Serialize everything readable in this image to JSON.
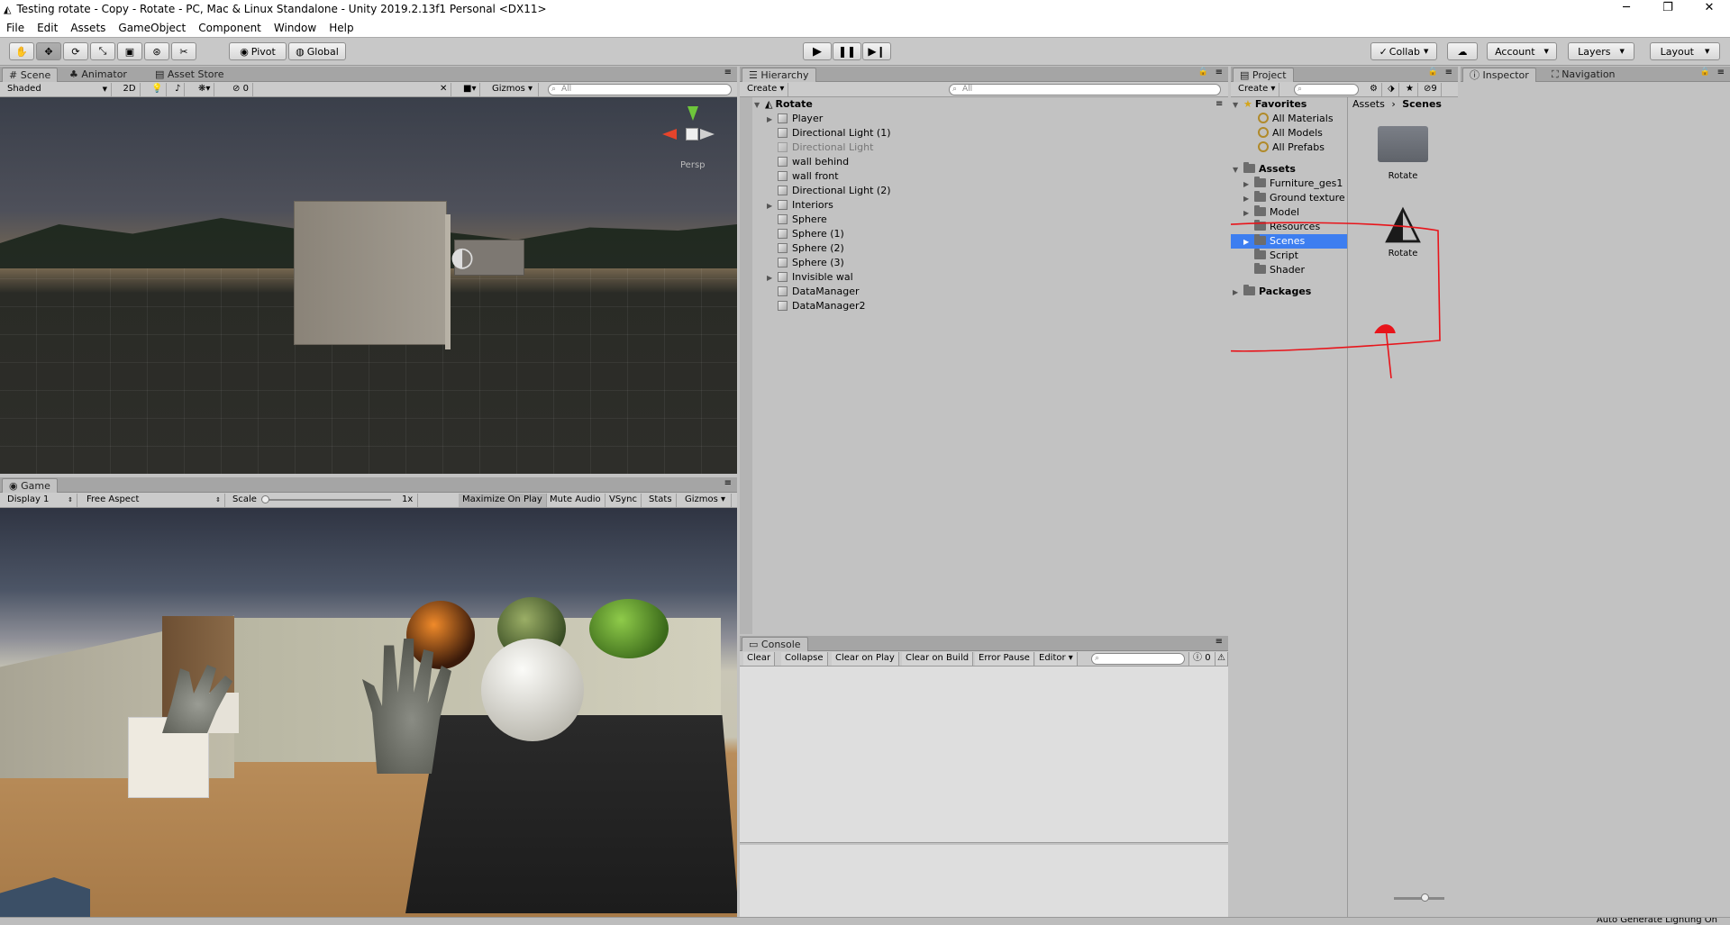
{
  "window": {
    "title": "Testing rotate - Copy - Rotate - PC, Mac & Linux Standalone - Unity 2019.2.13f1 Personal <DX11>",
    "controls": [
      "─",
      "❐",
      "✕"
    ]
  },
  "menu": [
    "File",
    "Edit",
    "Assets",
    "GameObject",
    "Component",
    "Window",
    "Help"
  ],
  "toolbar": {
    "pivot": "Pivot",
    "global": "Global",
    "collab": "Collab",
    "account": "Account",
    "layers": "Layers",
    "layout": "Layout"
  },
  "scene": {
    "tabs": [
      "Scene",
      "Animator",
      "Asset Store"
    ],
    "shading": "Shaded",
    "mode2d": "2D",
    "hidden_count": "0",
    "gizmos": "Gizmos",
    "search_placeholder": "All",
    "persp": "Persp"
  },
  "game": {
    "tab": "Game",
    "display": "Display 1",
    "aspect": "Free Aspect",
    "scale_label": "Scale",
    "scale_value": "1x",
    "maximize": "Maximize On Play",
    "mute": "Mute Audio",
    "vsync": "VSync",
    "stats": "Stats",
    "gizmos": "Gizmos"
  },
  "hierarchy": {
    "tab": "Hierarchy",
    "create": "Create",
    "search_placeholder": "All",
    "scene_name": "Rotate",
    "items": [
      {
        "label": "Player",
        "expandable": true,
        "dim": false
      },
      {
        "label": "Directional Light (1)",
        "expandable": false,
        "dim": false
      },
      {
        "label": "Directional Light",
        "expandable": false,
        "dim": true
      },
      {
        "label": "wall behind",
        "expandable": false,
        "dim": false
      },
      {
        "label": "wall front",
        "expandable": false,
        "dim": false
      },
      {
        "label": "Directional Light (2)",
        "expandable": false,
        "dim": false
      },
      {
        "label": "Interiors",
        "expandable": true,
        "dim": false
      },
      {
        "label": "Sphere",
        "expandable": false,
        "dim": false
      },
      {
        "label": "Sphere (1)",
        "expandable": false,
        "dim": false
      },
      {
        "label": "Sphere (2)",
        "expandable": false,
        "dim": false
      },
      {
        "label": "Sphere (3)",
        "expandable": false,
        "dim": false
      },
      {
        "label": "Invisible wal",
        "expandable": true,
        "dim": false
      },
      {
        "label": "DataManager",
        "expandable": false,
        "dim": false
      },
      {
        "label": "DataManager2",
        "expandable": false,
        "dim": false
      }
    ]
  },
  "console": {
    "tab": "Console",
    "buttons": [
      "Clear",
      "Collapse",
      "Clear on Play",
      "Clear on Build",
      "Error Pause",
      "Editor"
    ],
    "error_count": "0"
  },
  "project": {
    "tab": "Project",
    "create": "Create",
    "layer_count": "9",
    "favorites": "Favorites",
    "favorite_items": [
      "All Materials",
      "All Models",
      "All Prefabs"
    ],
    "assets": "Assets",
    "folders": [
      {
        "label": "Furniture_ges1",
        "expandable": true
      },
      {
        "label": "Ground texture",
        "expandable": true
      },
      {
        "label": "Model",
        "expandable": true
      },
      {
        "label": "Resources",
        "expandable": false
      },
      {
        "label": "Scenes",
        "expandable": true
      },
      {
        "label": "Script",
        "expandable": false
      },
      {
        "label": "Shader",
        "expandable": false
      }
    ],
    "packages": "Packages",
    "breadcrumb": [
      "Assets",
      "Scenes"
    ],
    "grid_items": [
      {
        "label": "Rotate",
        "icon": "folder-icon"
      },
      {
        "label": "Rotate",
        "icon": "unity-scene-icon"
      }
    ]
  },
  "inspector": {
    "tabs": [
      "Inspector",
      "Navigation"
    ]
  },
  "status": {
    "text": "Auto Generate Lighting On"
  },
  "colors": {
    "selection": "#3d7ef0",
    "annotation": "#e8141a",
    "panel_bg": "#c2c2c2"
  }
}
